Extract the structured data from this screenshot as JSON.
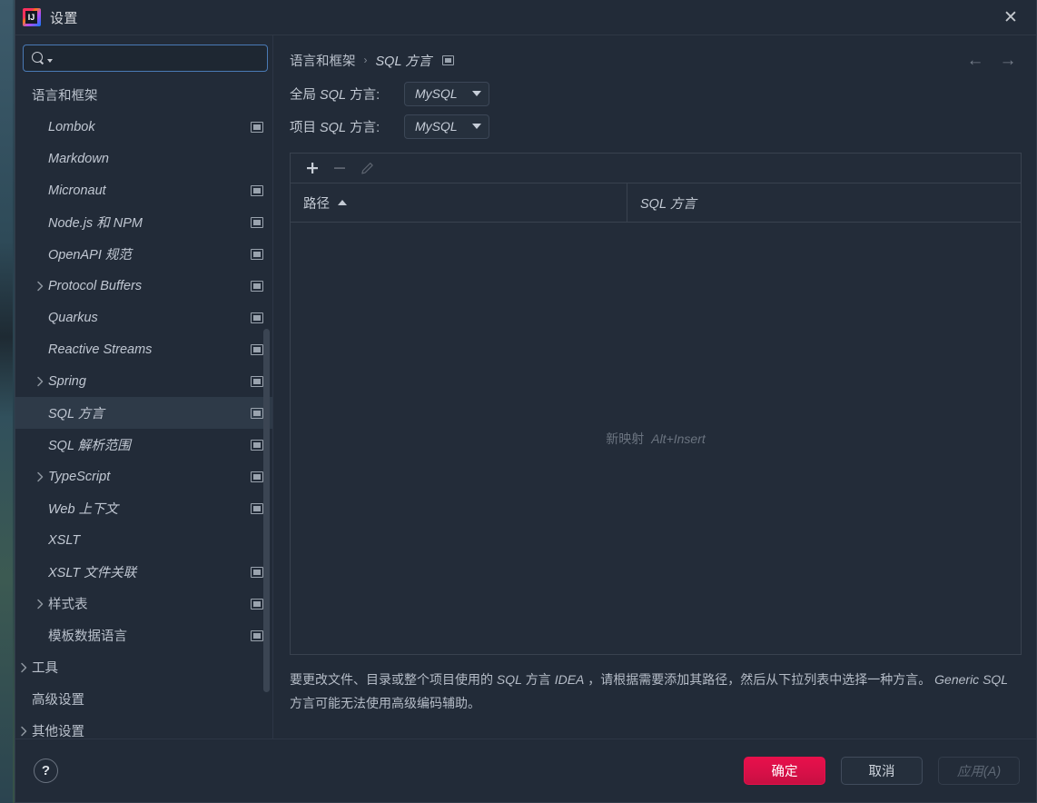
{
  "window": {
    "title": "设置",
    "app_icon": "intellij-idea-icon",
    "close_label": "✕"
  },
  "search": {
    "value": "",
    "placeholder": "",
    "icon": "search-icon"
  },
  "sidebar": {
    "scroll": {
      "top_pct": 38,
      "height_pct": 55
    },
    "items": [
      {
        "label": "语言和框架",
        "level": 0,
        "italic": false,
        "expandable": false,
        "expanded": false,
        "module_icon": false,
        "selected": false
      },
      {
        "label": "Lombok",
        "level": 1,
        "italic": true,
        "expandable": false,
        "expanded": false,
        "module_icon": true,
        "selected": false
      },
      {
        "label": "Markdown",
        "level": 1,
        "italic": true,
        "expandable": false,
        "expanded": false,
        "module_icon": false,
        "selected": false
      },
      {
        "label": "Micronaut",
        "level": 1,
        "italic": true,
        "expandable": false,
        "expanded": false,
        "module_icon": true,
        "selected": false
      },
      {
        "label": "Node.js 和 NPM",
        "level": 1,
        "italic": true,
        "expandable": false,
        "expanded": false,
        "module_icon": true,
        "selected": false
      },
      {
        "label": "OpenAPI 规范",
        "level": 1,
        "italic": true,
        "expandable": false,
        "expanded": false,
        "module_icon": true,
        "selected": false
      },
      {
        "label": "Protocol Buffers",
        "level": 1,
        "italic": true,
        "expandable": true,
        "expanded": false,
        "module_icon": true,
        "selected": false
      },
      {
        "label": "Quarkus",
        "level": 1,
        "italic": true,
        "expandable": false,
        "expanded": false,
        "module_icon": true,
        "selected": false
      },
      {
        "label": "Reactive Streams",
        "level": 1,
        "italic": true,
        "expandable": false,
        "expanded": false,
        "module_icon": true,
        "selected": false
      },
      {
        "label": "Spring",
        "level": 1,
        "italic": true,
        "expandable": true,
        "expanded": false,
        "module_icon": true,
        "selected": false
      },
      {
        "label": "SQL 方言",
        "level": 1,
        "italic": true,
        "expandable": false,
        "expanded": false,
        "module_icon": true,
        "selected": true
      },
      {
        "label": "SQL 解析范围",
        "level": 1,
        "italic": true,
        "expandable": false,
        "expanded": false,
        "module_icon": true,
        "selected": false
      },
      {
        "label": "TypeScript",
        "level": 1,
        "italic": true,
        "expandable": true,
        "expanded": false,
        "module_icon": true,
        "selected": false
      },
      {
        "label": "Web 上下文",
        "level": 1,
        "italic": true,
        "expandable": false,
        "expanded": false,
        "module_icon": true,
        "selected": false
      },
      {
        "label": "XSLT",
        "level": 1,
        "italic": true,
        "expandable": false,
        "expanded": false,
        "module_icon": false,
        "selected": false
      },
      {
        "label": "XSLT 文件关联",
        "level": 1,
        "italic": true,
        "expandable": false,
        "expanded": false,
        "module_icon": true,
        "selected": false
      },
      {
        "label": "样式表",
        "level": 1,
        "italic": false,
        "expandable": true,
        "expanded": false,
        "module_icon": true,
        "selected": false
      },
      {
        "label": "模板数据语言",
        "level": 1,
        "italic": false,
        "expandable": false,
        "expanded": false,
        "module_icon": true,
        "selected": false
      },
      {
        "label": "工具",
        "level": 0,
        "italic": false,
        "expandable": true,
        "expanded": false,
        "module_icon": false,
        "selected": false
      },
      {
        "label": "高级设置",
        "level": 0,
        "italic": false,
        "expandable": false,
        "expanded": false,
        "module_icon": false,
        "selected": false
      },
      {
        "label": "其他设置",
        "level": 0,
        "italic": false,
        "expandable": true,
        "expanded": false,
        "module_icon": false,
        "selected": false
      }
    ]
  },
  "breadcrumb": {
    "parent": "语言和框架",
    "separator": "›",
    "current": "SQL 方言",
    "module_icon": "module-settings-icon"
  },
  "nav": {
    "back_icon": "←",
    "forward_icon": "→"
  },
  "fields": {
    "global": {
      "label_cn_prefix": "全局",
      "label_it": "SQL",
      "label_cn_suffix": "方言:",
      "value": "MySQL"
    },
    "project": {
      "label_cn_prefix": "项目",
      "label_it": "SQL",
      "label_cn_suffix": "方言:",
      "value": "MySQL"
    }
  },
  "toolbar": {
    "add_icon": "plus-icon",
    "remove_icon": "minus-icon",
    "edit_icon": "pencil-icon"
  },
  "table": {
    "columns": [
      {
        "label": "路径",
        "sorted": "asc",
        "italic": false
      },
      {
        "label": "SQL 方言",
        "sorted": "none",
        "italic": true
      }
    ],
    "rows": [],
    "empty_label": "新映射",
    "empty_shortcut": "Alt+Insert"
  },
  "hint": {
    "part1": "要更改文件、目录或整个项目使用的",
    "it1": "SQL",
    "part2": "方言",
    "it2": "IDEA",
    "part3": "，请根据需要添加其路径，然后从下拉列表中选择一种方言。",
    "it3": "Generic SQL",
    "part4": "方言可能无法使用高级编码辅助。"
  },
  "footer": {
    "help_label": "?",
    "ok_label": "确定",
    "cancel_label": "取消",
    "apply_label": "应用(A)",
    "apply_enabled": false
  },
  "colors": {
    "window_bg": "#222b38",
    "panel_bg": "#232c39",
    "selection": "#2e3a48",
    "accent_primary": "#e8104b",
    "focus_border": "#4a7ab5",
    "text": "#c3cad4",
    "muted_text": "#6a737f"
  }
}
